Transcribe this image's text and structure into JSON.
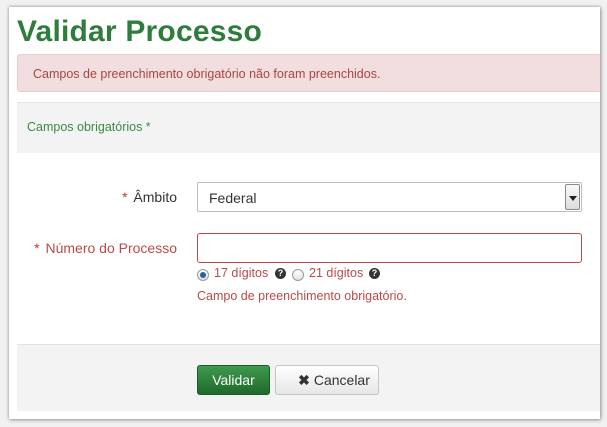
{
  "page": {
    "title": "Validar Processo"
  },
  "alert": {
    "message": "Campos de preenchimento obrigatório não foram preenchidos."
  },
  "section": {
    "header": "Campos obrigatórios *"
  },
  "form": {
    "required_marker": "*",
    "ambito": {
      "label": "Âmbito",
      "selected": "Federal"
    },
    "numero_processo": {
      "label": "Número do Processo",
      "value": "",
      "error": "Campo de preenchimento obrigatório.",
      "options": [
        {
          "label": "17 dígitos",
          "checked": true,
          "help": "?"
        },
        {
          "label": "21 dígitos",
          "checked": false,
          "help": "?"
        }
      ]
    }
  },
  "buttons": {
    "validar": "Validar",
    "cancelar": "Cancelar",
    "cancelar_icon": "close-icon"
  },
  "colors": {
    "title": "#2e7d3c",
    "alert_bg": "#f2dede",
    "alert_text": "#a94442",
    "error": "#b94a48",
    "primary_button": "#2a7d38"
  }
}
